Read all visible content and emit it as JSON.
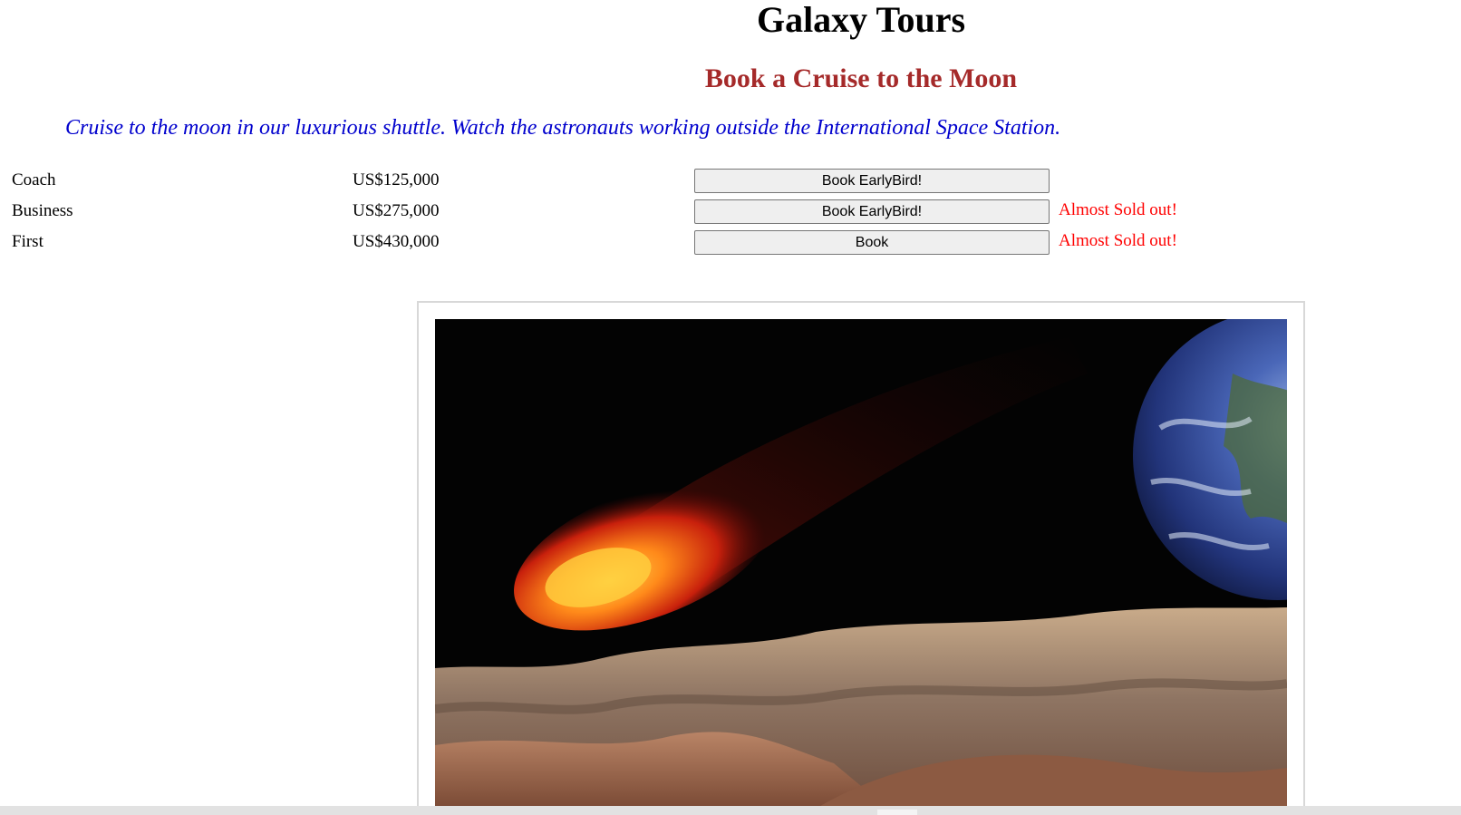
{
  "header": {
    "title": "Galaxy Tours",
    "subtitle": "Book a Cruise to the Moon",
    "tagline": "Cruise to the moon in our luxurious shuttle. Watch the astronauts working outside the International Space Station."
  },
  "fares": [
    {
      "class": "Coach",
      "price": "US$125,000",
      "button": "Book EarlyBird!",
      "status": ""
    },
    {
      "class": "Business",
      "price": "US$275,000",
      "button": "Book EarlyBird!",
      "status": "Almost Sold out!"
    },
    {
      "class": "First",
      "price": "US$430,000",
      "button": "Book",
      "status": "Almost Sold out!"
    }
  ],
  "colors": {
    "subtitle": "#a52a2a",
    "tagline": "#0000cd",
    "status": "#ff0000"
  },
  "hero": {
    "icon": "moon-earth-comet-image"
  }
}
